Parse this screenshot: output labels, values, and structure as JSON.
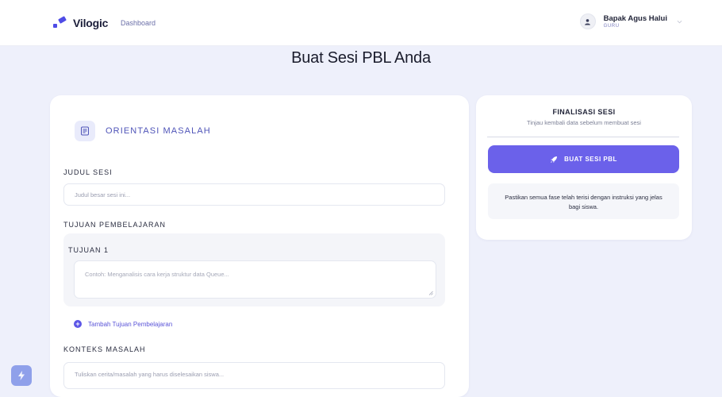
{
  "app": {
    "brand": "Vilogic",
    "nav_dashboard": "Dashboard"
  },
  "user": {
    "name": "Bapak Agus Halui",
    "role": "GURU"
  },
  "page": {
    "title": "Buat Sesi PBL Anda"
  },
  "form": {
    "section_title": "ORIENTASI MASALAH",
    "judul_label": "JUDUL SESI",
    "judul_placeholder": "Judul besar sesi ini...",
    "tujuan_label": "TUJUAN PEMBELAJARAN",
    "goals": [
      {
        "label": "TUJUAN 1",
        "placeholder": "Contoh: Menganalisis cara kerja struktur data Queue..."
      }
    ],
    "add_goal_label": "Tambah Tujuan Pembelajaran",
    "konteks_label": "KONTEKS MASALAH",
    "konteks_placeholder": "Tuliskan cerita/masalah yang harus diselesaikan siswa..."
  },
  "sidebar": {
    "title": "FINALISASI SESI",
    "subtitle": "Tinjau kembali data sebelum membuat sesi",
    "button_label": "BUAT SESI PBL",
    "note": "Pastikan semua fase telah terisi dengan instruksi yang jelas bagi siswa."
  },
  "colors": {
    "accent": "#6b61ea",
    "background": "#eef0fb",
    "section_text": "#4f54b8"
  },
  "icons": {
    "brand": "vilogic-logo-icon",
    "user": "user-icon",
    "dropdown": "chevron-down-icon",
    "section": "clipboard-list-icon",
    "add": "plus-circle-icon",
    "button": "rocket-icon",
    "fab": "lightning-icon"
  }
}
